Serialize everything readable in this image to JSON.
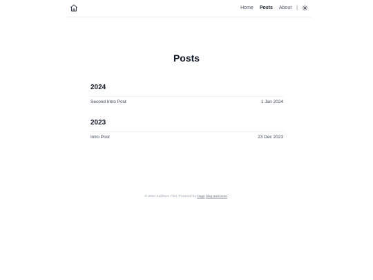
{
  "header": {
    "home_icon": "home-icon",
    "nav": {
      "home": "Home",
      "posts": "Posts",
      "about": "About",
      "separator": "|"
    },
    "theme_icon": "sun-icon"
  },
  "main": {
    "title": "Posts",
    "groups": [
      {
        "year": "2024",
        "posts": [
          {
            "title": "Second Intro Post",
            "date": "1 Jan 2024"
          }
        ]
      },
      {
        "year": "2023",
        "posts": [
          {
            "title": "Intro Post",
            "date": "23 Dec 2023"
          }
        ]
      }
    ]
  },
  "footer": {
    "copyright": "© 2024 Kathleen Flint.",
    "powered_prefix": "Powered by",
    "hugo": "Hugo",
    "theme": "blog awesome",
    "suffix": "."
  },
  "colors": {
    "text": "#1f2937",
    "heading": "#111827",
    "muted": "#9ca3af"
  }
}
